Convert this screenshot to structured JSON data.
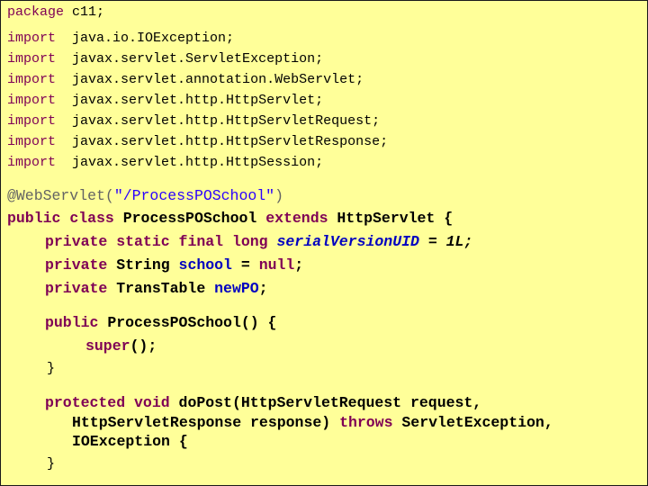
{
  "code": {
    "package_line": {
      "keyword": "package",
      "name": "c11;"
    },
    "imports": [
      {
        "keyword": "import",
        "name": "java.io.IOException;"
      },
      {
        "keyword": "import",
        "name": "javax.servlet.ServletException;"
      },
      {
        "keyword": "import",
        "name": "javax.servlet.annotation.WebServlet;"
      },
      {
        "keyword": "import",
        "name": "javax.servlet.http.HttpServlet;"
      },
      {
        "keyword": "import",
        "name": "javax.servlet.http.HttpServletRequest;"
      },
      {
        "keyword": "import",
        "name": "javax.servlet.http.HttpServletResponse;"
      },
      {
        "keyword": "import",
        "name": "javax.servlet.http.HttpSession;"
      }
    ],
    "annotation": {
      "name": "@WebServlet(",
      "value": "\"/ProcessPOSchool\"",
      "close": ")"
    },
    "class_decl": {
      "kw1": "public",
      "kw2": "class",
      "name": "ProcessPOSchool",
      "kw3": "extends",
      "parent": "HttpServlet {"
    },
    "field1": {
      "kw1": "private",
      "kw2": "static",
      "kw3": "final",
      "kw4": "long",
      "name": "serialVersionUID",
      "rest": " = 1L;"
    },
    "field2": {
      "kw1": "private",
      "type": "String",
      "name": "school",
      "eq": " = ",
      "null": "null",
      "semi": ";"
    },
    "field3": {
      "kw1": "private",
      "type": "TransTable",
      "name": "newPO",
      "semi": ";"
    },
    "ctor": {
      "kw1": "public",
      "name": "ProcessPOSchool() {"
    },
    "super_call": {
      "kw": "super",
      "rest": "();"
    },
    "ctor_close": "}",
    "method": {
      "kw1": "protected",
      "kw2": "void",
      "sig1": "doPost(HttpServletRequest request,",
      "sig2a": "HttpServletResponse response)",
      "throws": "throws",
      "sig2b": "ServletException,",
      "sig3": "IOException {"
    },
    "method_close": "}"
  }
}
